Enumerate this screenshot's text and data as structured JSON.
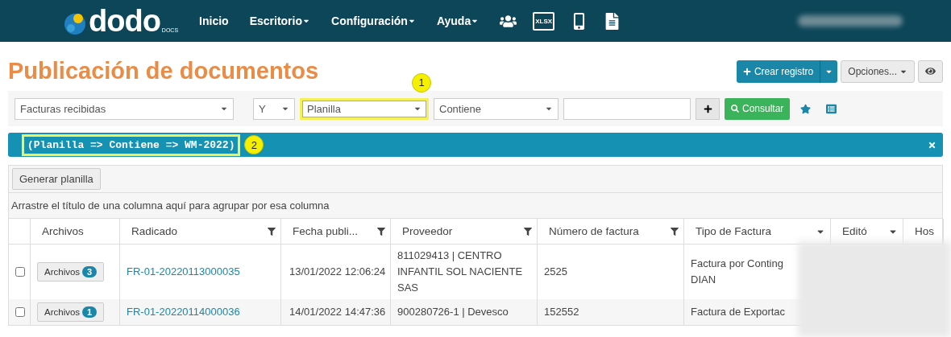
{
  "navbar": {
    "logo": "dodo",
    "logo_sub": "DOCS",
    "menu": [
      {
        "label": "Inicio",
        "dropdown": false
      },
      {
        "label": "Escritorio",
        "dropdown": true
      },
      {
        "label": "Configuración",
        "dropdown": true
      },
      {
        "label": "Ayuda",
        "dropdown": true
      }
    ],
    "icons": [
      {
        "kind": "users"
      },
      {
        "kind": "xlsx",
        "label": "XLSX"
      },
      {
        "kind": "phone"
      },
      {
        "kind": "doc"
      }
    ]
  },
  "page_title": "Publicación de documentos",
  "actions": {
    "create": "Crear registro",
    "options": "Opciones..."
  },
  "filters": [
    {
      "kind": "select",
      "value": "Facturas recibidas"
    },
    {
      "kind": "select",
      "value": "Y"
    },
    {
      "kind": "select",
      "value": "Planilla",
      "highlighted": true,
      "annotation": "1"
    },
    {
      "kind": "select",
      "value": "Contiene"
    },
    {
      "kind": "input"
    }
  ],
  "consult_button": "Consultar",
  "filter_bar": {
    "text": "(Planilla => Contiene => WM-2022)",
    "highlighted": true,
    "annotation": "2"
  },
  "grid": {
    "toolbar_button": "Generar planilla",
    "group_hint": "Arrastre el título de una columna aquí para agrupar por esa columna",
    "columns": [
      {
        "label": "Archivos",
        "has_filter": false,
        "has_menu": false
      },
      {
        "label": "Radicado",
        "has_filter": true,
        "has_menu": false
      },
      {
        "label": "Fecha publi...",
        "has_filter": true,
        "has_menu": false
      },
      {
        "label": "Proveedor",
        "has_filter": true,
        "has_menu": false
      },
      {
        "label": "Número de factura",
        "has_filter": true,
        "has_menu": false
      },
      {
        "label": "Tipo de Factura",
        "has_filter": false,
        "has_menu": true
      },
      {
        "label": "Editó",
        "has_filter": false,
        "has_menu": true
      },
      {
        "label": "Hos",
        "has_filter": false,
        "has_menu": false
      }
    ],
    "rows": [
      {
        "checked": false,
        "files_label": "Archivos",
        "files_count": "3",
        "radicado": "FR-01-20220113000035",
        "fecha": "13/01/2022 12:06:24",
        "proveedor": "811029413 | CENTRO INFANTIL SOL NACIENTE SAS",
        "numero": "2525",
        "tipo": "Factura por Conting DIAN"
      },
      {
        "checked": false,
        "files_label": "Archivos",
        "files_count": "1",
        "radicado": "FR-01-20220114000036",
        "fecha": "14/01/2022 14:47:36",
        "proveedor": "900280726-1 | Devesco",
        "numero": "152552",
        "tipo": "Factura de Exportac"
      }
    ]
  }
}
